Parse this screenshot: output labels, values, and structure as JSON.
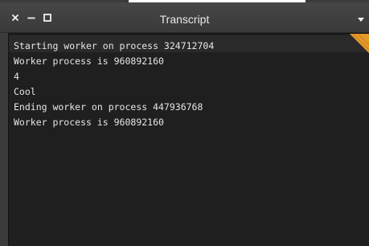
{
  "window": {
    "title": "Transcript"
  },
  "titlebar": {
    "close_icon": "close-icon",
    "minimize_icon": "minimize-icon",
    "maximize_icon": "maximize-icon",
    "menu_icon": "dropdown-triangle-icon"
  },
  "transcript": {
    "lines": [
      "Starting worker on process 324712704",
      "Worker process is 960892160",
      "4",
      "Cool",
      "Ending worker on process 447936768",
      "Worker process is 960892160"
    ]
  },
  "colors": {
    "titlebar": "#3f3f3f",
    "content_background": "#1f1f1f",
    "text": "#e6e6e6",
    "accent": "#e59a2a"
  }
}
